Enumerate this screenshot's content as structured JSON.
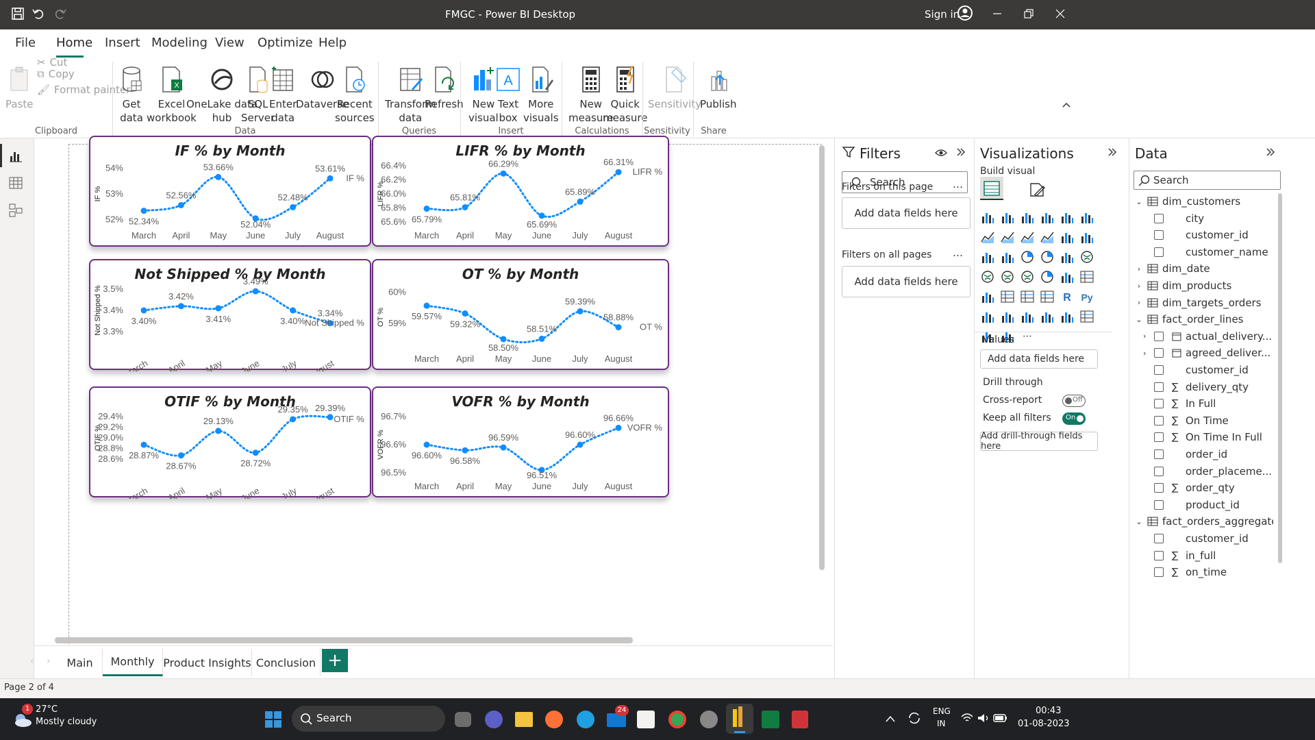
{
  "window": {
    "title": "FMGC - Power BI Desktop",
    "sign_in": "Sign in"
  },
  "menu": [
    "File",
    "Home",
    "Insert",
    "Modeling",
    "View",
    "Optimize",
    "Help"
  ],
  "ribbon": {
    "clipboard": {
      "paste": "Paste",
      "cut": "Cut",
      "copy": "Copy",
      "format_painter": "Format painter",
      "group": "Clipboard"
    },
    "data": {
      "get_data": [
        "Get",
        "data"
      ],
      "excel": [
        "Excel",
        "workbook"
      ],
      "onelake": [
        "OneLake data",
        "hub"
      ],
      "sql": [
        "SQL",
        "Server"
      ],
      "enter": [
        "Enter",
        "data"
      ],
      "dataverse": [
        "Dataverse",
        ""
      ],
      "recent": [
        "Recent",
        "sources"
      ],
      "group": "Data"
    },
    "queries": {
      "transform": [
        "Transform",
        "data"
      ],
      "refresh": [
        "Refresh",
        ""
      ],
      "group": "Queries"
    },
    "insert": {
      "new_visual": [
        "New",
        "visual"
      ],
      "text_box": [
        "Text",
        "box"
      ],
      "more_visuals": [
        "More",
        "visuals"
      ],
      "group": "Insert"
    },
    "calculations": {
      "new_measure": [
        "New",
        "measure"
      ],
      "quick_measure": [
        "Quick",
        "measure"
      ],
      "group": "Calculations"
    },
    "sensitivity": {
      "label": "Sensitivity",
      "group": "Sensitivity"
    },
    "share": {
      "publish": "Publish",
      "group": "Share"
    }
  },
  "chart_data": [
    {
      "type": "line",
      "title": "IF % by Month",
      "ylabel": "IF %",
      "legend": "IF %",
      "categories": [
        "March",
        "April",
        "May",
        "June",
        "July",
        "August"
      ],
      "values": [
        52.34,
        52.56,
        53.66,
        52.04,
        52.48,
        53.61
      ],
      "labels": [
        "52.34%",
        "52.56%",
        "53.66%",
        "52.04%",
        "52.48%",
        "53.61%"
      ],
      "yticks": [
        "54%",
        "53%",
        "52%"
      ],
      "ylim": [
        51.9,
        54.1
      ]
    },
    {
      "type": "line",
      "title": "LIFR % by Month",
      "ylabel": "LIFR %",
      "legend": "LIFR %",
      "categories": [
        "March",
        "April",
        "May",
        "June",
        "July",
        "August"
      ],
      "values": [
        65.79,
        65.81,
        66.29,
        65.69,
        65.89,
        66.31
      ],
      "labels": [
        "65.79%",
        "65.81%",
        "66.29%",
        "65.69%",
        "65.89%",
        "66.31%"
      ],
      "yticks": [
        "66.4%",
        "66.2%",
        "66.0%",
        "65.8%",
        "65.6%"
      ],
      "ylim": [
        65.6,
        66.4
      ]
    },
    {
      "type": "line",
      "title": "Not Shipped % by Month",
      "ylabel": "Not Shipped %",
      "legend": "Not Shipped %",
      "categories": [
        "March",
        "April",
        "May",
        "June",
        "July",
        "August"
      ],
      "values": [
        3.4,
        3.42,
        3.41,
        3.49,
        3.4,
        3.34
      ],
      "labels": [
        "3.40%",
        "3.42%",
        "3.41%",
        "3.49%",
        "3.40%",
        "3.34%"
      ],
      "yticks": [
        "3.5%",
        "3.4%",
        "3.3%"
      ],
      "ylim": [
        3.3,
        3.5
      ]
    },
    {
      "type": "line",
      "title": "OT % by Month",
      "ylabel": "OT %",
      "legend": "OT %",
      "categories": [
        "March",
        "April",
        "May",
        "June",
        "July",
        "August"
      ],
      "values": [
        59.57,
        59.32,
        58.5,
        58.51,
        59.39,
        58.88
      ],
      "labels": [
        "59.57%",
        "59.32%",
        "58.50%",
        "58.51%",
        "59.39%",
        "58.88%"
      ],
      "yticks": [
        "60%",
        "59%"
      ],
      "ylim": [
        58.3,
        60.1
      ]
    },
    {
      "type": "line",
      "title": "OTIF % by Month",
      "ylabel": "OTIF %",
      "legend": "OTIF %",
      "categories": [
        "March",
        "April",
        "May",
        "June",
        "July",
        "August"
      ],
      "values": [
        28.87,
        28.67,
        29.13,
        28.72,
        29.35,
        29.39
      ],
      "labels": [
        "28.87%",
        "28.67%",
        "29.13%",
        "28.72%",
        "29.35%",
        "29.39%"
      ],
      "yticks": [
        "29.4%",
        "29.2%",
        "29.0%",
        "28.8%",
        "28.6%"
      ],
      "ylim": [
        28.6,
        29.4
      ]
    },
    {
      "type": "line",
      "title": "VOFR % by Month",
      "ylabel": "VOFR %",
      "legend": "VOFR %",
      "categories": [
        "March",
        "April",
        "May",
        "June",
        "July",
        "August"
      ],
      "values": [
        96.6,
        96.58,
        96.59,
        96.51,
        96.6,
        96.66
      ],
      "labels": [
        "96.60%",
        "96.58%",
        "96.59%",
        "96.51%",
        "96.60%",
        "96.66%"
      ],
      "yticks": [
        "96.7%",
        "96.6%",
        "96.5%"
      ],
      "ylim": [
        96.5,
        96.7
      ]
    }
  ],
  "filters": {
    "title": "Filters",
    "search": "Search",
    "on_page": "Filters on this page",
    "all_pages": "Filters on all pages",
    "add": "Add data fields here"
  },
  "viz": {
    "title": "Visualizations",
    "build": "Build visual",
    "values": "Values",
    "add": "Add data fields here",
    "drill": "Drill through",
    "cross": "Cross-report",
    "cross_state": "Off",
    "keep": "Keep all filters",
    "keep_state": "On",
    "add_drill": "Add drill-through fields here"
  },
  "data": {
    "title": "Data",
    "search": "Search",
    "tree": [
      {
        "t": "dim_customers",
        "lvl": 0,
        "kind": "table",
        "open": true
      },
      {
        "t": "city",
        "lvl": 1,
        "kind": "field"
      },
      {
        "t": "customer_id",
        "lvl": 1,
        "kind": "field"
      },
      {
        "t": "customer_name",
        "lvl": 1,
        "kind": "field"
      },
      {
        "t": "dim_date",
        "lvl": 0,
        "kind": "table",
        "open": false
      },
      {
        "t": "dim_products",
        "lvl": 0,
        "kind": "table",
        "open": false
      },
      {
        "t": "dim_targets_orders",
        "lvl": 0,
        "kind": "table",
        "open": false
      },
      {
        "t": "fact_order_lines",
        "lvl": 0,
        "kind": "table",
        "open": true
      },
      {
        "t": "actual_delivery...",
        "lvl": 1,
        "kind": "date"
      },
      {
        "t": "agreed_deliver...",
        "lvl": 1,
        "kind": "date"
      },
      {
        "t": "customer_id",
        "lvl": 1,
        "kind": "field"
      },
      {
        "t": "delivery_qty",
        "lvl": 1,
        "kind": "sum"
      },
      {
        "t": "In Full",
        "lvl": 1,
        "kind": "sum"
      },
      {
        "t": "On Time",
        "lvl": 1,
        "kind": "sum"
      },
      {
        "t": "On Time In Full",
        "lvl": 1,
        "kind": "sum"
      },
      {
        "t": "order_id",
        "lvl": 1,
        "kind": "field"
      },
      {
        "t": "order_placeme...",
        "lvl": 1,
        "kind": "field"
      },
      {
        "t": "order_qty",
        "lvl": 1,
        "kind": "sum"
      },
      {
        "t": "product_id",
        "lvl": 1,
        "kind": "field"
      },
      {
        "t": "fact_orders_aggregate",
        "lvl": 0,
        "kind": "table",
        "open": true
      },
      {
        "t": "customer_id",
        "lvl": 1,
        "kind": "field"
      },
      {
        "t": "in_full",
        "lvl": 1,
        "kind": "sum"
      },
      {
        "t": "on_time",
        "lvl": 1,
        "kind": "sum"
      }
    ]
  },
  "tabs": [
    "Main",
    "Monthly",
    "Product Insights",
    "Conclusion"
  ],
  "active_tab": "Monthly",
  "status": "Page 2 of 4",
  "taskbar": {
    "temp": "27°C",
    "weather": "Mostly cloudy",
    "search": "Search",
    "lang1": "ENG",
    "lang2": "IN",
    "time": "00:43",
    "date": "01-08-2023",
    "badge_weather": "1",
    "badge_mail": "24"
  },
  "colors": {
    "accent_line": "#118dff",
    "card_border": "#6b2d83",
    "title_bar": "#3b3a39",
    "taskbar": "#202124"
  }
}
